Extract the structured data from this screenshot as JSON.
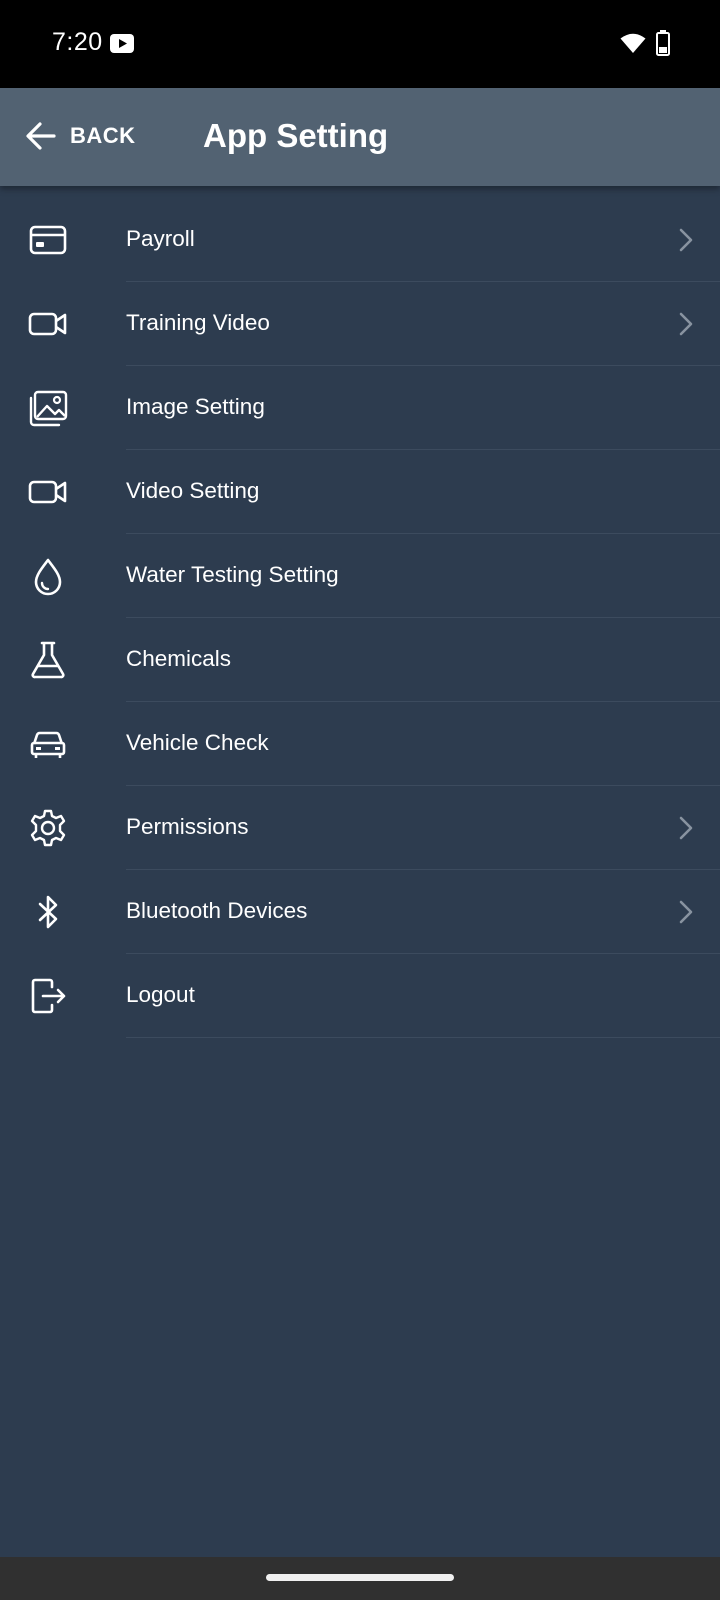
{
  "status_bar": {
    "time": "7:20",
    "icons": [
      "youtube-icon",
      "wifi-icon",
      "battery-icon"
    ]
  },
  "header": {
    "back_label": "BACK",
    "title": "App Setting",
    "back_icon": "arrow-left-icon"
  },
  "menu": {
    "items": [
      {
        "label": "Payroll",
        "icon": "card-icon",
        "chevron": true
      },
      {
        "label": "Training Video",
        "icon": "video-camera-icon",
        "chevron": true
      },
      {
        "label": "Image Setting",
        "icon": "image-icon",
        "chevron": false
      },
      {
        "label": "Video Setting",
        "icon": "video-camera-icon",
        "chevron": false
      },
      {
        "label": "Water Testing Setting",
        "icon": "water-drop-icon",
        "chevron": false
      },
      {
        "label": "Chemicals",
        "icon": "flask-icon",
        "chevron": false
      },
      {
        "label": "Vehicle Check",
        "icon": "car-icon",
        "chevron": false
      },
      {
        "label": "Permissions",
        "icon": "gear-icon",
        "chevron": true
      },
      {
        "label": "Bluetooth Devices",
        "icon": "bluetooth-icon",
        "chevron": true
      },
      {
        "label": "Logout",
        "icon": "logout-icon",
        "chevron": false
      }
    ]
  },
  "colors": {
    "background": "#2d3c4f",
    "app_bar": "#526272",
    "divider": "#3c4b5e",
    "chevron": "#8893a0",
    "text": "#ffffff"
  }
}
